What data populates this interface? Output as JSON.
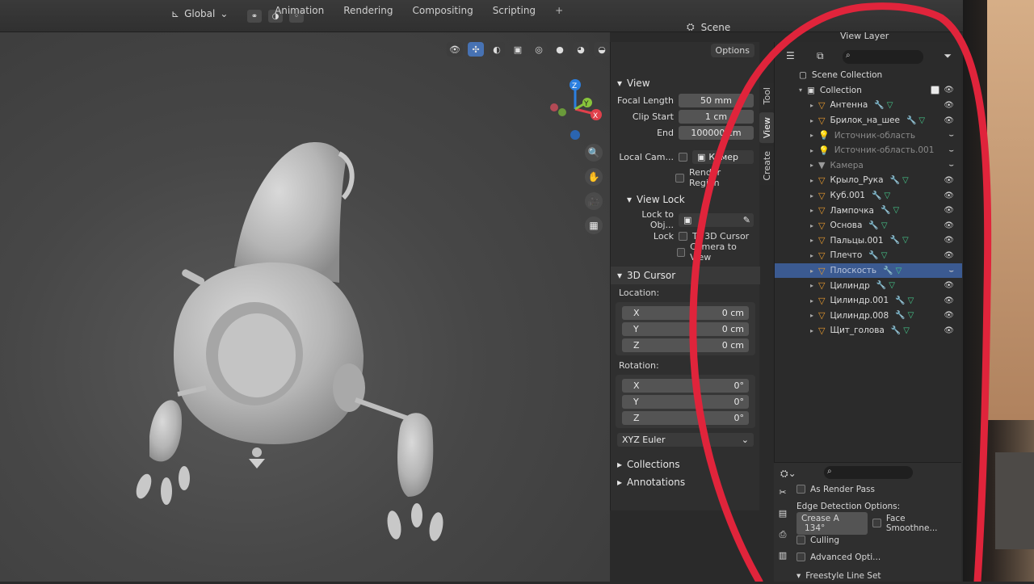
{
  "topbar": {
    "orientation_label": "Global",
    "tabs": [
      "Animation",
      "Rendering",
      "Compositing",
      "Scripting",
      "+"
    ],
    "scene_label": "Scene",
    "view_layer_label": "View Layer"
  },
  "npanel": {
    "options_label": "Options",
    "view_section": "View",
    "focal_length_label": "Focal Length",
    "focal_length_value": "50 mm",
    "clip_start_label": "Clip Start",
    "clip_start_value": "1 cm",
    "end_label": "End",
    "end_value": "100000 cm",
    "local_camera_label": "Local Cam...",
    "local_camera_value": "Камер",
    "render_region_label": "Render Region",
    "view_lock_section": "View Lock",
    "lock_to_object_label": "Lock to Obj...",
    "lock_label": "Lock",
    "to_3d_cursor_label": "To 3D Cursor",
    "camera_to_view_label": "Camera to View",
    "cursor_section": "3D Cursor",
    "location_label": "Location:",
    "loc_x_label": "X",
    "loc_x_value": "0 cm",
    "loc_y_label": "Y",
    "loc_y_value": "0 cm",
    "loc_z_label": "Z",
    "loc_z_value": "0 cm",
    "rotation_label": "Rotation:",
    "rot_x_label": "X",
    "rot_x_value": "0°",
    "rot_y_label": "Y",
    "rot_y_value": "0°",
    "rot_z_label": "Z",
    "rot_z_value": "0°",
    "rotation_mode": "XYZ Euler",
    "collections_section": "Collections",
    "annotations_section": "Annotations",
    "vtabs": [
      "Tool",
      "View",
      "Create"
    ]
  },
  "outliner": {
    "scene_collection": "Scene Collection",
    "collection": "Collection",
    "items": [
      {
        "name": "Антенна",
        "type": "mesh",
        "dim": false,
        "selected": false
      },
      {
        "name": "Брилок_на_шее",
        "type": "mesh",
        "dim": false,
        "selected": false
      },
      {
        "name": "Источник-область",
        "type": "light",
        "dim": true,
        "selected": false
      },
      {
        "name": "Источник-область.001",
        "type": "light",
        "dim": true,
        "selected": false
      },
      {
        "name": "Камера",
        "type": "camera",
        "dim": true,
        "selected": false
      },
      {
        "name": "Крыло_Рука",
        "type": "mesh",
        "dim": false,
        "selected": false
      },
      {
        "name": "Куб.001",
        "type": "mesh",
        "dim": false,
        "selected": false
      },
      {
        "name": "Лампочка",
        "type": "mesh",
        "dim": false,
        "selected": false
      },
      {
        "name": "Основа",
        "type": "mesh",
        "dim": false,
        "selected": false
      },
      {
        "name": "Пальцы.001",
        "type": "mesh",
        "dim": false,
        "selected": false
      },
      {
        "name": "Плечто",
        "type": "mesh",
        "dim": false,
        "selected": false
      },
      {
        "name": "Плоскость",
        "type": "mesh",
        "dim": true,
        "selected": true
      },
      {
        "name": "Цилиндр",
        "type": "mesh",
        "dim": false,
        "selected": false
      },
      {
        "name": "Цилиндр.001",
        "type": "mesh",
        "dim": false,
        "selected": false
      },
      {
        "name": "Цилиндр.008",
        "type": "mesh",
        "dim": false,
        "selected": false
      },
      {
        "name": "Щит_голова",
        "type": "mesh",
        "dim": false,
        "selected": false
      }
    ]
  },
  "properties": {
    "as_render_pass": "As Render Pass",
    "edge_detection": "Edge Detection Options:",
    "crease_label": "Crease A",
    "crease_value": "134°",
    "face_smoothness": "Face Smoothne...",
    "culling": "Culling",
    "advanced": "Advanced Opti...",
    "freestyle_line_set": "Freestyle Line Set"
  },
  "colors": {
    "accent_blue": "#4772b3",
    "selection_row": "#3b5a91",
    "object_orange": "#e89a2d",
    "modifier_wrench": "#6f97d3",
    "mesh_green": "#46c98c",
    "annotation_red": "#e0243b"
  }
}
